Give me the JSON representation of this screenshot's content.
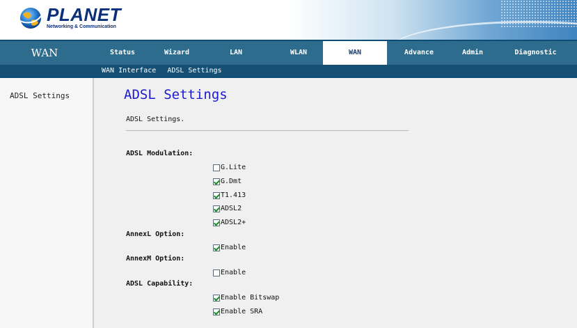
{
  "header": {
    "brand": "PLANET",
    "tagline": "Networking & Communication"
  },
  "nav": {
    "section_title": "WAN",
    "tabs": [
      {
        "label": "Status",
        "active": false
      },
      {
        "label": "Wizard",
        "active": false
      },
      {
        "label": "LAN",
        "active": false
      },
      {
        "label": "WLAN",
        "active": false
      },
      {
        "label": "WAN",
        "active": true
      },
      {
        "label": "Advance",
        "active": false
      },
      {
        "label": "Admin",
        "active": false
      },
      {
        "label": "Diagnostic",
        "active": false
      }
    ]
  },
  "subnav": {
    "items": [
      "WAN Interface",
      "ADSL Settings"
    ]
  },
  "sidebar": {
    "items": [
      "ADSL Settings"
    ]
  },
  "main": {
    "title": "ADSL Settings",
    "description": "ADSL Settings.",
    "sections": [
      {
        "label": "ADSL Modulation:",
        "options": [
          {
            "label": "G.Lite",
            "checked": false
          },
          {
            "label": "G.Dmt",
            "checked": true
          },
          {
            "label": "T1.413",
            "checked": true
          },
          {
            "label": "ADSL2",
            "checked": true
          },
          {
            "label": "ADSL2+",
            "checked": true
          }
        ]
      },
      {
        "label": "AnnexL Option:",
        "options": [
          {
            "label": "Enable",
            "checked": true
          }
        ]
      },
      {
        "label": "AnnexM Option:",
        "options": [
          {
            "label": "Enable",
            "checked": false
          }
        ]
      },
      {
        "label": "ADSL Capability:",
        "options": [
          {
            "label": "Enable Bitswap",
            "checked": true
          },
          {
            "label": "Enable SRA",
            "checked": true
          }
        ]
      }
    ]
  },
  "colors": {
    "nav_bg": "#2e6c8e",
    "subnav_bg": "#154f73",
    "title_blue": "#1a1ad0",
    "brand_blue": "#0b2f7a"
  }
}
